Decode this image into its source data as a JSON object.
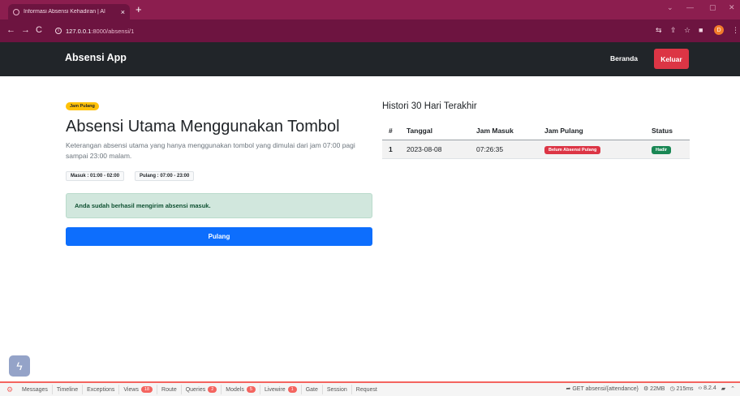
{
  "browser": {
    "tab_title": "Informasi Absensi Kehadiran | Al",
    "tab_close": "×",
    "new_tab": "+",
    "url_host": "127.0.0.1",
    "url_path": ":8000/absensi/1",
    "profile_initial": "D"
  },
  "navbar": {
    "brand": "Absensi App",
    "home_label": "Beranda",
    "logout_label": "Keluar"
  },
  "main": {
    "badge": "Jam Pulang",
    "title": "Absensi Utama Menggunakan Tombol",
    "description": "Keterangan absensi utama yang hanya menggunakan tombol yang dimulai dari jam 07:00 pagi sampai 23:00 malam.",
    "tag_in": "Masuk : 01:00 - 02:00",
    "tag_out": "Pulang : 07:00 - 23:00",
    "alert": "Anda sudah berhasil mengirim absensi masuk.",
    "button": "Pulang"
  },
  "history": {
    "title": "Histori 30 Hari Terakhir",
    "headers": [
      "#",
      "Tanggal",
      "Jam Masuk",
      "Jam Pulang",
      "Status"
    ],
    "rows": [
      {
        "no": "1",
        "date": "2023-08-08",
        "in": "07:26:35",
        "out": "Belum Absensi Pulang",
        "status": "Hadir"
      }
    ]
  },
  "debugbar": {
    "items": [
      {
        "label": "Messages"
      },
      {
        "label": "Timeline"
      },
      {
        "label": "Exceptions"
      },
      {
        "label": "Views",
        "count": "18"
      },
      {
        "label": "Route"
      },
      {
        "label": "Queries",
        "count": "2"
      },
      {
        "label": "Models",
        "count": "5"
      },
      {
        "label": "Livewire",
        "count": "1"
      },
      {
        "label": "Gate"
      },
      {
        "label": "Session"
      },
      {
        "label": "Request"
      }
    ],
    "request": "GET absensi/{attendance}",
    "memory": "22MB",
    "time": "215ms",
    "php": "8.2.4"
  },
  "colors": {
    "browser_tab": "#8c1e4f",
    "address_bar": "#6d1440",
    "navbar": "#212529",
    "danger": "#dc3545",
    "primary": "#0d6efd",
    "success_bg": "#d1e7dd",
    "warning": "#ffc107",
    "debug_accent": "#f4645f"
  }
}
